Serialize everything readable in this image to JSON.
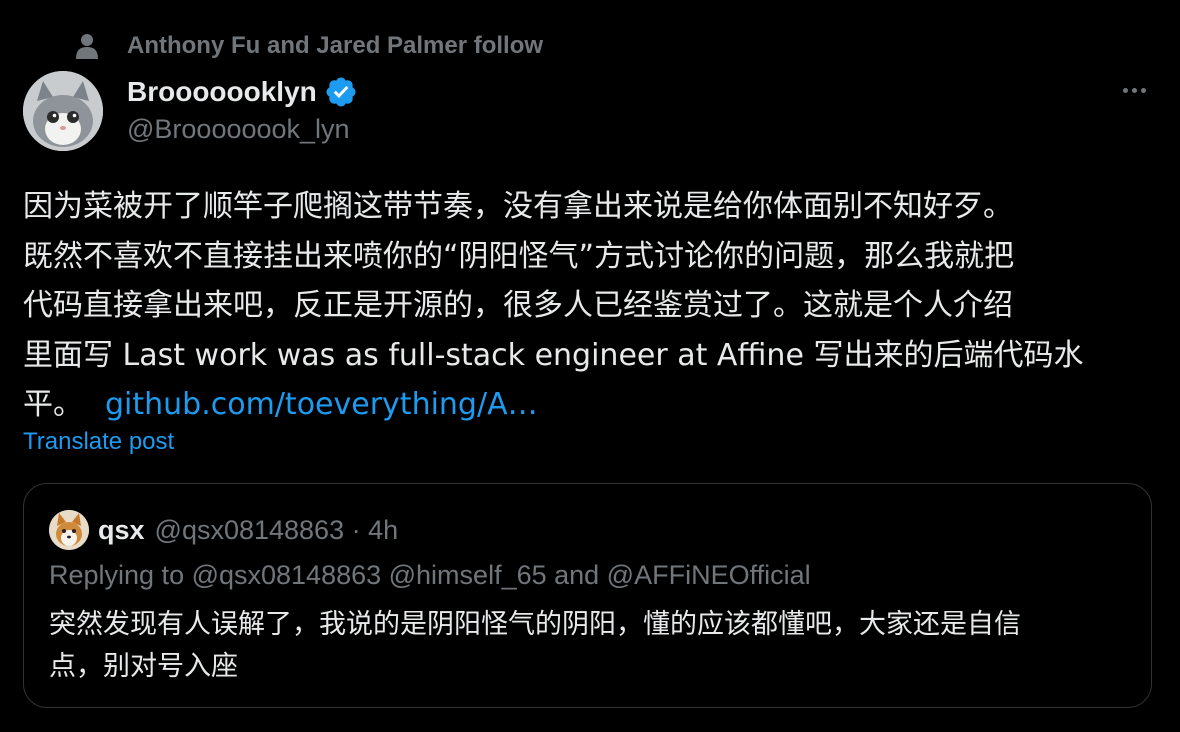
{
  "social_context": {
    "text": "Anthony Fu and Jared Palmer follow",
    "icon": "person-icon"
  },
  "tweet": {
    "author": {
      "display_name": "Brooooooklyn",
      "handle": "@Broooooook_lyn",
      "verified": true
    },
    "text_lines": [
      "因为菜被开了顺竿子爬搁这带节奏，没有拿出来说是给你体面别不知好歹。",
      "既然不喜欢不直接挂出来喷你的“阴阳怪气”方式讨论你的问题，那么我就把",
      "代码直接拿出来吧，反正是开源的，很多人已经鉴赏过了。这就是个人介绍",
      "里面写 Last work was as full-stack engineer at Affine 写出来的后端代码水",
      "平。"
    ],
    "link_text": "github.com/toeverything/A…",
    "translate_label": "Translate post"
  },
  "quote": {
    "name": "qsx",
    "meta": "@qsx08148863 · 4h",
    "replying": "Replying to @qsx08148863 @himself_65 and @AFFiNEOfficial",
    "text_lines": [
      "突然发现有人误解了，我说的是阴阳怪气的阴阳，懂的应该都懂吧，大家还是自信",
      "点，别对号入座"
    ]
  },
  "colors": {
    "background": "#000000",
    "text": "#e7e9ea",
    "secondary": "#71767b",
    "accent": "#1d9bf0",
    "border": "#2f3336"
  }
}
